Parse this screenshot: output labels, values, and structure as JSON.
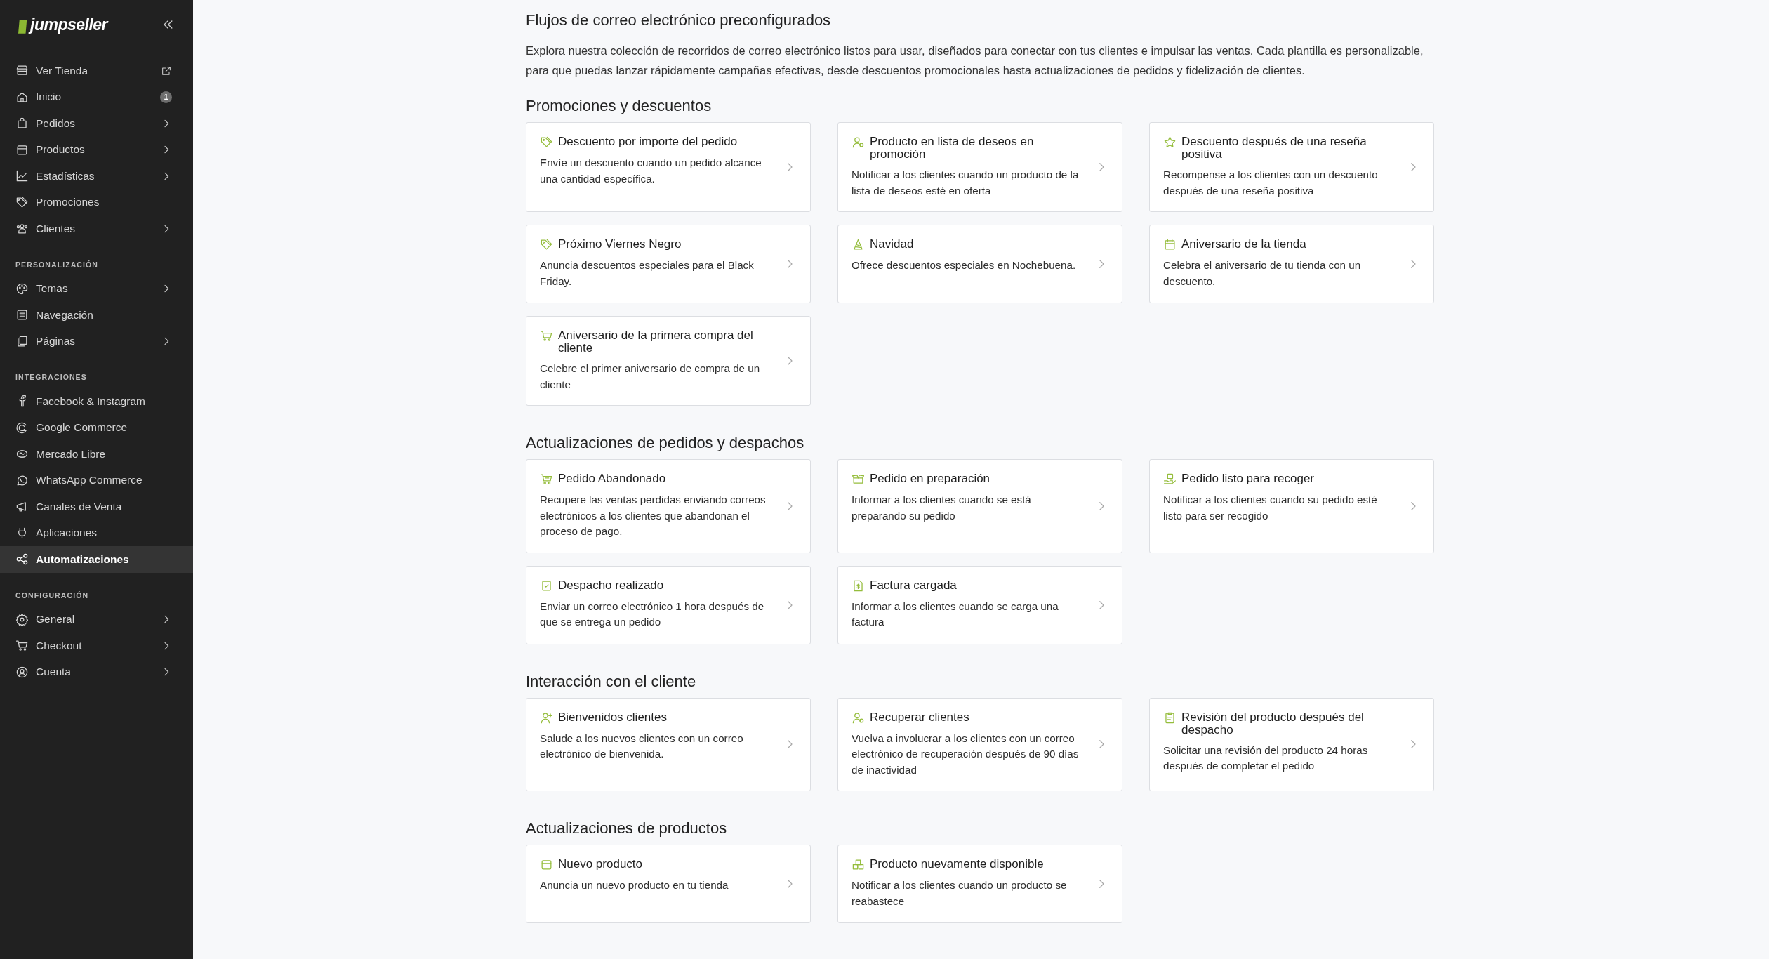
{
  "sidebar": {
    "logo": "jumpseller",
    "groups": [
      {
        "items": [
          {
            "label": "Ver Tienda",
            "kind": "external",
            "selected": false
          },
          {
            "label": "Inicio",
            "kind": "badge",
            "badge": "1",
            "selected": false
          },
          {
            "label": "Pedidos",
            "kind": "expandable",
            "selected": false
          },
          {
            "label": "Productos",
            "kind": "expandable",
            "selected": false
          },
          {
            "label": "Estadísticas",
            "kind": "expandable",
            "selected": false
          },
          {
            "label": "Promociones",
            "kind": "plain",
            "selected": false
          },
          {
            "label": "Clientes",
            "kind": "expandable",
            "selected": false
          }
        ]
      },
      {
        "heading": "PERSONALIZACIÓN",
        "items": [
          {
            "label": "Temas",
            "kind": "expandable",
            "selected": false
          },
          {
            "label": "Navegación",
            "kind": "plain",
            "selected": false
          },
          {
            "label": "Páginas",
            "kind": "expandable",
            "selected": false
          }
        ]
      },
      {
        "heading": "INTEGRACIONES",
        "items": [
          {
            "label": "Facebook & Instagram",
            "kind": "plain",
            "selected": false
          },
          {
            "label": "Google Commerce",
            "kind": "plain",
            "selected": false
          },
          {
            "label": "Mercado Libre",
            "kind": "plain",
            "selected": false
          },
          {
            "label": "WhatsApp Commerce",
            "kind": "plain",
            "selected": false
          },
          {
            "label": "Canales de Venta",
            "kind": "plain",
            "selected": false
          },
          {
            "label": "Aplicaciones",
            "kind": "plain",
            "selected": false
          },
          {
            "label": "Automatizaciones",
            "kind": "plain",
            "selected": true
          }
        ]
      },
      {
        "heading": "CONFIGURACIÓN",
        "items": [
          {
            "label": "General",
            "kind": "expandable",
            "selected": false
          },
          {
            "label": "Checkout",
            "kind": "expandable",
            "selected": false
          },
          {
            "label": "Cuenta",
            "kind": "expandable",
            "selected": false
          }
        ]
      }
    ]
  },
  "main": {
    "title": "Flujos de correo electrónico preconfigurados",
    "intro": "Explora nuestra colección de recorridos de correo electrónico listos para usar, diseñados para conectar con tus clientes e impulsar las ventas. Cada plantilla es personalizable, para que puedas lanzar rápidamente campañas efectivas, desde descuentos promocionales hasta actualizaciones de pedidos y fidelización de clientes.",
    "sections": [
      {
        "title": "Promociones y descuentos",
        "cards": [
          {
            "title": "Descuento por importe del pedido",
            "description": "Envíe un descuento cuando un pedido alcance una cantidad específica."
          },
          {
            "title": "Producto en lista de deseos en promoción",
            "description": "Notificar a los clientes cuando un producto de la lista de deseos esté en oferta"
          },
          {
            "title": "Descuento después de una reseña positiva",
            "description": "Recompense a los clientes con un descuento después de una reseña positiva"
          },
          {
            "title": "Próximo Viernes Negro",
            "description": "Anuncia descuentos especiales para el Black Friday."
          },
          {
            "title": "Navidad",
            "description": "Ofrece descuentos especiales en Nochebuena."
          },
          {
            "title": "Aniversario de la tienda",
            "description": "Celebra el aniversario de tu tienda con un descuento."
          },
          {
            "title": "Aniversario de la primera compra del cliente",
            "description": "Celebre el primer aniversario de compra de un cliente"
          }
        ]
      },
      {
        "title": "Actualizaciones de pedidos y despachos",
        "cards": [
          {
            "title": "Pedido Abandonado",
            "description": "Recupere las ventas perdidas enviando correos electrónicos a los clientes que abandonan el proceso de pago."
          },
          {
            "title": "Pedido en preparación",
            "description": "Informar a los clientes cuando se está preparando su pedido"
          },
          {
            "title": "Pedido listo para recoger",
            "description": "Notificar a los clientes cuando su pedido esté listo para ser recogido"
          },
          {
            "title": "Despacho realizado",
            "description": "Enviar un correo electrónico 1 hora después de que se entrega un pedido"
          },
          {
            "title": "Factura cargada",
            "description": "Informar a los clientes cuando se carga una factura"
          }
        ]
      },
      {
        "title": "Interacción con el cliente",
        "cards": [
          {
            "title": "Bienvenidos clientes",
            "description": "Salude a los nuevos clientes con un correo electrónico de bienvenida."
          },
          {
            "title": "Recuperar clientes",
            "description": "Vuelva a involucrar a los clientes con un correo electrónico de recuperación después de 90 días de inactividad"
          },
          {
            "title": "Revisión del producto después del despacho",
            "description": "Solicitar una revisión del producto 24 horas después de completar el pedido"
          }
        ]
      },
      {
        "title": "Actualizaciones de productos",
        "cards": [
          {
            "title": "Nuevo producto",
            "description": "Anuncia un nuevo producto en tu tienda"
          },
          {
            "title": "Producto nuevamente disponible",
            "description": "Notificar a los clientes cuando un producto se reabastece"
          }
        ]
      }
    ]
  }
}
